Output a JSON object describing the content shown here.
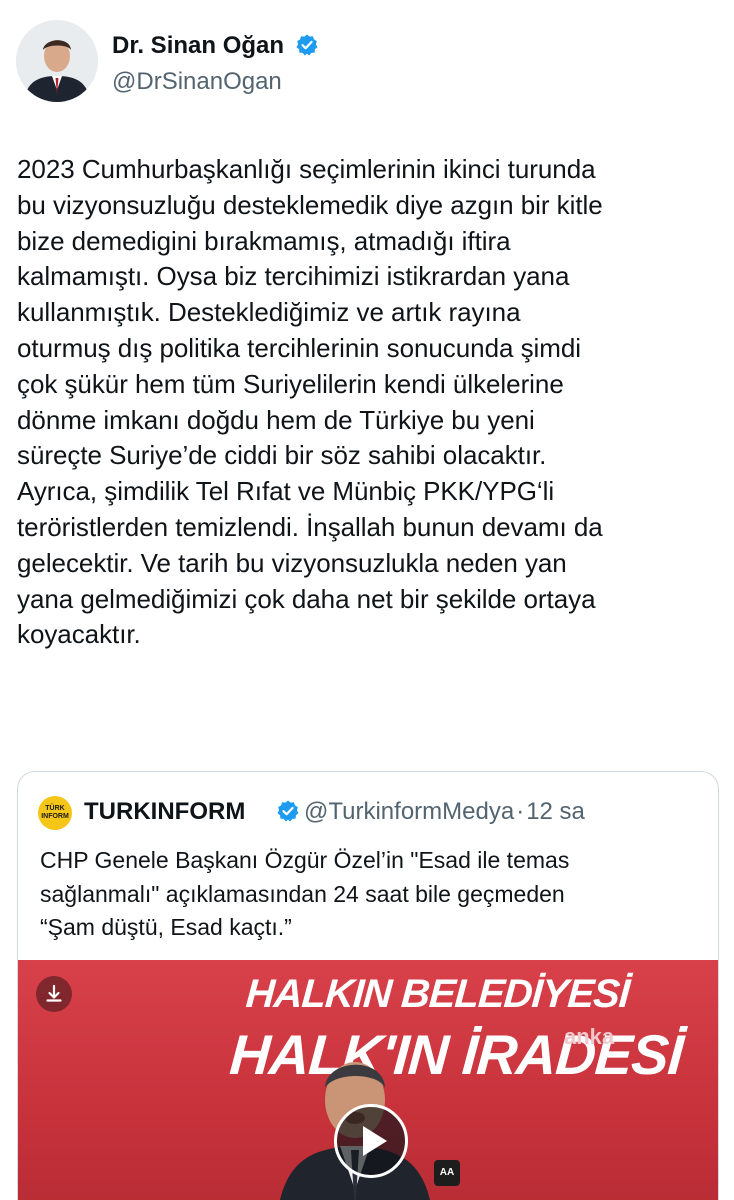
{
  "author": {
    "name": "Dr. Sinan Oğan",
    "handle": "@DrSinanOgan",
    "avatar_icon": "profile-photo"
  },
  "tweet": {
    "text": "2023 Cumhurbaşkanlığı seçimlerinin ikinci turunda\nbu vizyonsuzluğu desteklemedik diye azgın bir kitle\nbize demedigini bırakmamış, atmadığı iftira\nkalmamıştı. Oysa biz tercihimizi istikrardan yana\nkullanmıştık. Desteklediğimiz ve artık rayına\noturmuş dış politika tercihlerinin sonucunda şimdi\nçok şükür hem tüm Suriyelilerin kendi ülkelerine\ndönme imkanı doğdu hem de Türkiye bu yeni\nsüreçte Suriye’de ciddi bir söz sahibi olacaktır.\nAyrıca, şimdilik Tel Rıfat ve Münbiç PKK/YPG‘li\nteröristlerden temizlendi. İnşallah bunun devamı da\ngelecektir. Ve tarih bu vizyonsuzlukla neden yan\nyana gelmediğimizi çok daha net bir şekilde ortaya\nkoyacaktır."
  },
  "quoted": {
    "name": "TURKINFORM",
    "handle": "@TurkinformMedya",
    "separator": "·",
    "time": "12 sa",
    "avatar_text": "TÜRK\nINFORM",
    "text": "CHP Genele Başkanı Özgür Özel’in \"Esad ile temas\nsağlanmalı\" açıklamasından 24 saat bile geçmeden\n“Şam düştü, Esad kaçtı.”",
    "media": {
      "banner_line1": "HALKIN BELEDİYESİ",
      "banner_line2": "HALK'IN İRADESİ",
      "watermark": "anka",
      "logo": "AA",
      "download_icon": "download-icon",
      "play_icon": "play-icon"
    }
  },
  "colors": {
    "text": "#0f1419",
    "secondary": "#536471",
    "verified": "#1d9bf0",
    "border": "#cfd9de",
    "media_red": "#c8323b"
  }
}
